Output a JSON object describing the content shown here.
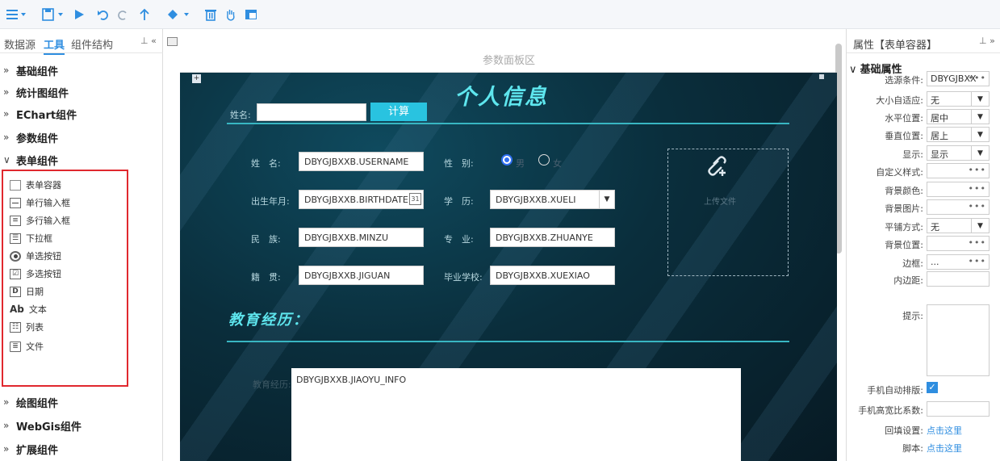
{
  "left_panel": {
    "tabs": [
      "数据源",
      "工具",
      "组件结构"
    ],
    "pin": "⊥ «",
    "categories_top": [
      "基础组件",
      "统计图组件",
      "EChart组件",
      "参数组件"
    ],
    "form_category": "表单组件",
    "form_items": [
      "表单容器",
      "单行输入框",
      "多行输入框",
      "下拉框",
      "单选按钮",
      "多选按钮",
      "日期",
      "文本",
      "列表",
      "文件"
    ],
    "text_icon": "Ab",
    "categories_bottom": [
      "绘图组件",
      "WebGis组件",
      "扩展组件"
    ]
  },
  "canvas": {
    "param_area": "参数面板区",
    "form": {
      "title": "个人信息",
      "search_label": "姓名:",
      "search_value": "",
      "calc_button": "计算",
      "fields": {
        "name_label": "姓　名:",
        "name_value": "DBYGJBXXB.USERNAME",
        "gender_label": "性　别:",
        "gender_male": "男",
        "gender_female": "女",
        "birth_label": "出生年月:",
        "birth_value": "DBYGJBXXB.BIRTHDATE",
        "edu_label": "学　历:",
        "edu_value": "DBYGJBXXB.XUELI",
        "nation_label": "民　族:",
        "nation_value": "DBYGJBXXB.MINZU",
        "major_label": "专　业:",
        "major_value": "DBYGJBXXB.ZHUANYE",
        "native_label": "籍　贯:",
        "native_value": "DBYGJBXXB.JIGUAN",
        "school_label": "毕业学校:",
        "school_value": "DBYGJBXXB.XUEXIAO"
      },
      "upload_label": "上传文件",
      "edu_section_title": "教育经历：",
      "edu_label": "教育经历:",
      "edu_value": "DBYGJBXXB.JIAOYU_INFO"
    }
  },
  "right_panel": {
    "title": "属性【表单容器】",
    "pin": "⊥ »",
    "section": "基础属性",
    "props": [
      {
        "label": "选源条件:",
        "value": "DBYGJBXX",
        "type": "dots"
      },
      {
        "label": "大小自适应:",
        "value": "无",
        "type": "select"
      },
      {
        "label": "水平位置:",
        "value": "居中",
        "type": "select"
      },
      {
        "label": "垂直位置:",
        "value": "居上",
        "type": "select"
      },
      {
        "label": "显示:",
        "value": "显示",
        "type": "select"
      },
      {
        "label": "自定义样式:",
        "value": "",
        "type": "dots"
      },
      {
        "label": "背景颜色:",
        "value": "",
        "type": "dots"
      },
      {
        "label": "背景图片:",
        "value": "",
        "type": "dots"
      },
      {
        "label": "平铺方式:",
        "value": "无",
        "type": "select"
      },
      {
        "label": "背景位置:",
        "value": "",
        "type": "dots"
      },
      {
        "label": "边框:",
        "value": "...",
        "type": "dots"
      },
      {
        "label": "内边距:",
        "value": "",
        "type": "text"
      }
    ],
    "tip_label": "提示:",
    "mobile_layout_label": "手机自动排版:",
    "mobile_ratio_label": "手机高宽比系数:",
    "fill_label": "回填设置:",
    "fill_link": "点击这里",
    "script_label": "脚本:",
    "script_link": "点击这里"
  },
  "colors": {
    "accent": "#2f8ee0",
    "highlight": "#e0282e",
    "form_cyan": "#5ee6ee",
    "button": "#29c3e0"
  }
}
